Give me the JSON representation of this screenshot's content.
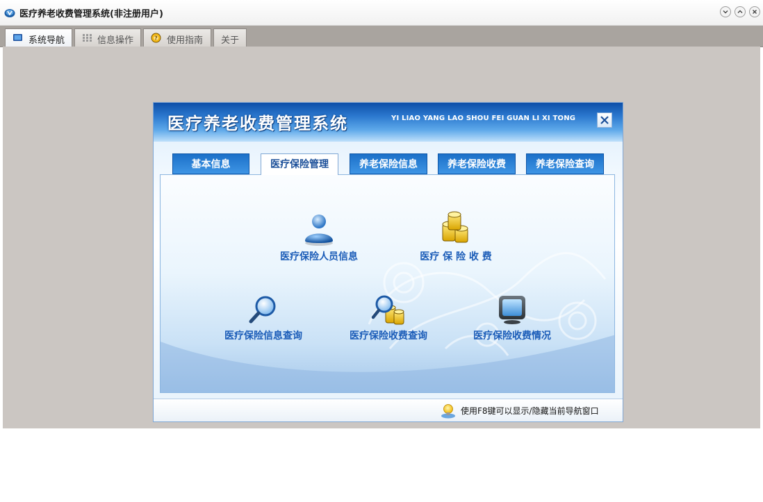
{
  "window": {
    "title": "医疗养老收费管理系统(非注册用户)",
    "controls": [
      "minimize",
      "maximize",
      "close"
    ]
  },
  "tabs": [
    {
      "label": "系统导航",
      "icon": "monitor-icon",
      "active": true
    },
    {
      "label": "信息操作",
      "icon": "grid-icon",
      "active": false
    },
    {
      "label": "使用指南",
      "icon": "help-icon",
      "active": false
    },
    {
      "label": "关于",
      "icon": "",
      "active": false
    }
  ],
  "panel": {
    "title": "医疗养老收费管理系统",
    "pinyin": "YI LIAO YANG LAO SHOU FEI GUAN LI XI TONG",
    "nav_tabs": [
      {
        "label": "基本信息",
        "active": false
      },
      {
        "label": "医疗保险管理",
        "active": true
      },
      {
        "label": "养老保险信息",
        "active": false
      },
      {
        "label": "养老保险收费",
        "active": false
      },
      {
        "label": "养老保险查询",
        "active": false
      }
    ],
    "items": [
      {
        "label": "医疗保险人员信息",
        "icon": "user-icon"
      },
      {
        "label": "医疗 保 险 收 费",
        "icon": "coins-icon"
      },
      {
        "label": "医疗保险信息查询",
        "icon": "magnifier-icon"
      },
      {
        "label": "医疗保险收费查询",
        "icon": "coin-search-icon"
      },
      {
        "label": "医疗保险收费情况",
        "icon": "monitor-icon"
      }
    ],
    "footer_hint": "使用F8键可以显示/隐藏当前导航窗口"
  },
  "colors": {
    "header_blue": "#2c79cf",
    "label_blue": "#1b5cb8",
    "workspace_gray": "#cbc6c2"
  }
}
